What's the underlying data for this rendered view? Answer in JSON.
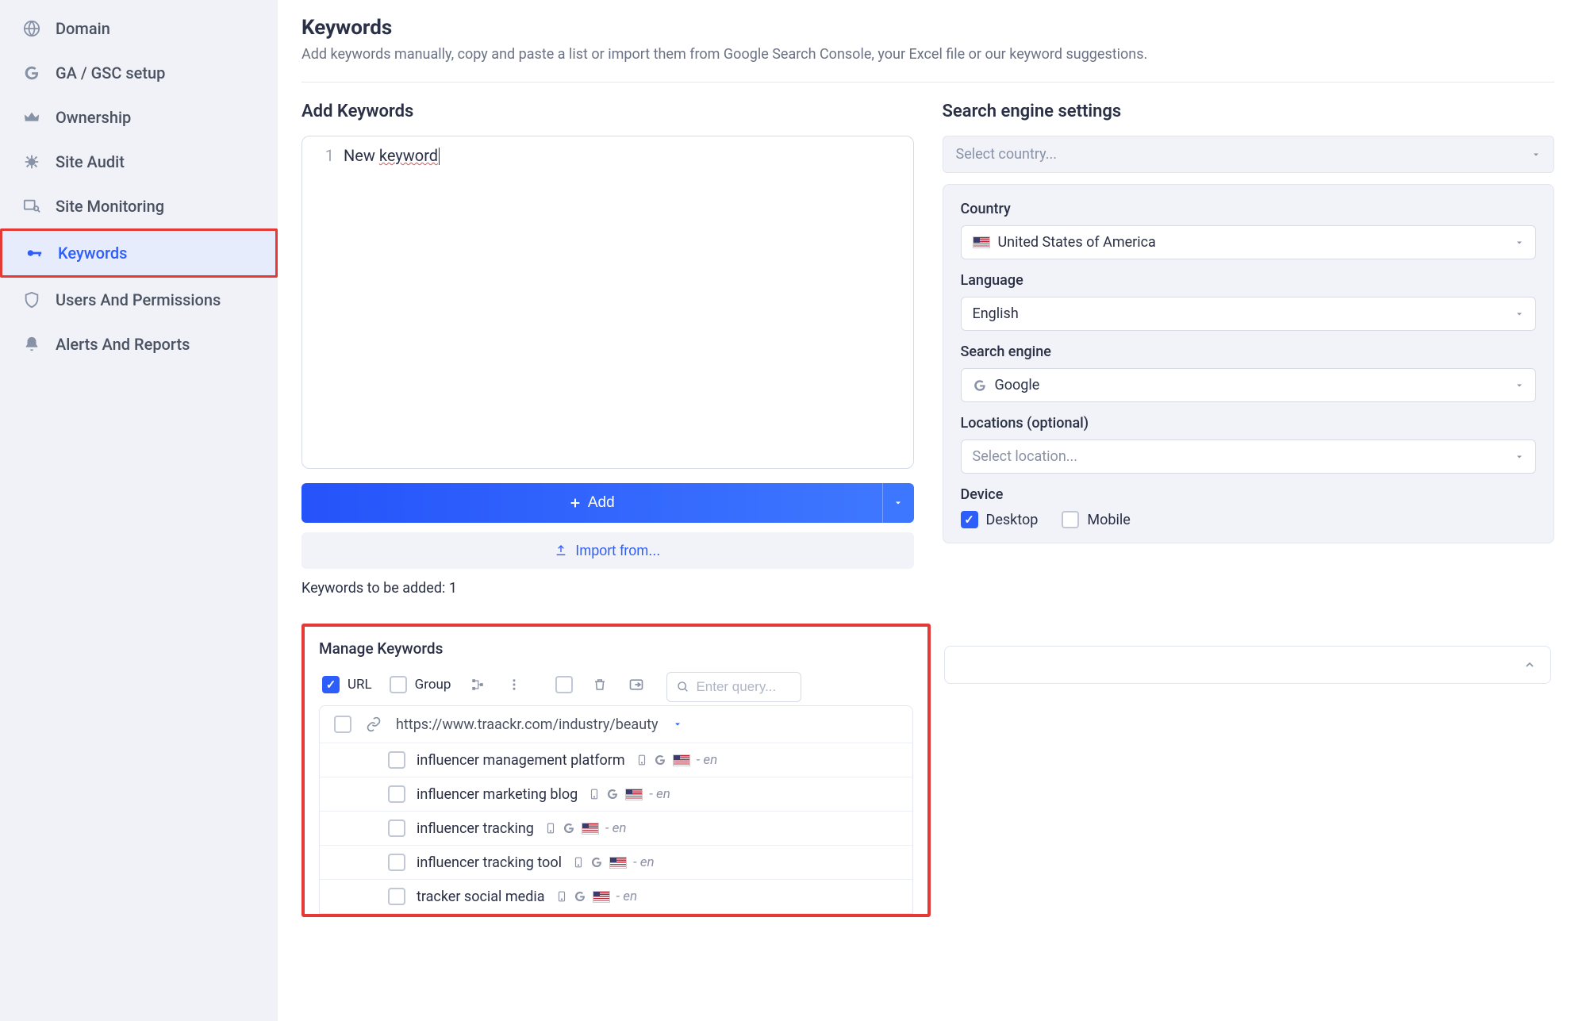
{
  "sidebar": {
    "items": [
      {
        "label": "Domain"
      },
      {
        "label": "GA / GSC setup"
      },
      {
        "label": "Ownership"
      },
      {
        "label": "Site Audit"
      },
      {
        "label": "Site Monitoring"
      },
      {
        "label": "Keywords"
      },
      {
        "label": "Users And Permissions"
      },
      {
        "label": "Alerts And Reports"
      }
    ]
  },
  "header": {
    "title": "Keywords",
    "subtitle": "Add keywords manually, copy and paste a list or import them from Google Search Console, your Excel file or our keyword suggestions."
  },
  "add": {
    "section_title": "Add Keywords",
    "line_number": "1",
    "input_prefix": "New ",
    "input_underlined": "keyword",
    "add_button": "Add",
    "import_button": "Import from...",
    "count_label": "Keywords to be added: 1"
  },
  "settings": {
    "section_title": "Search engine settings",
    "country_placeholder": "Select country...",
    "country_label": "Country",
    "country_value": "United States of America",
    "language_label": "Language",
    "language_value": "English",
    "engine_label": "Search engine",
    "engine_value": "Google",
    "locations_label": "Locations (optional)",
    "locations_placeholder": "Select location...",
    "device_label": "Device",
    "device_desktop": "Desktop",
    "device_mobile": "Mobile"
  },
  "manage": {
    "title": "Manage Keywords",
    "url_label": "URL",
    "group_label": "Group",
    "search_placeholder": "Enter query...",
    "url_value": "https://www.traackr.com/industry/beauty",
    "rows": [
      {
        "text": "influencer management platform",
        "lang": "- en"
      },
      {
        "text": "influencer marketing blog",
        "lang": "- en"
      },
      {
        "text": "influencer tracking",
        "lang": "- en"
      },
      {
        "text": "influencer tracking tool",
        "lang": "- en"
      },
      {
        "text": "tracker social media",
        "lang": "- en"
      }
    ]
  }
}
